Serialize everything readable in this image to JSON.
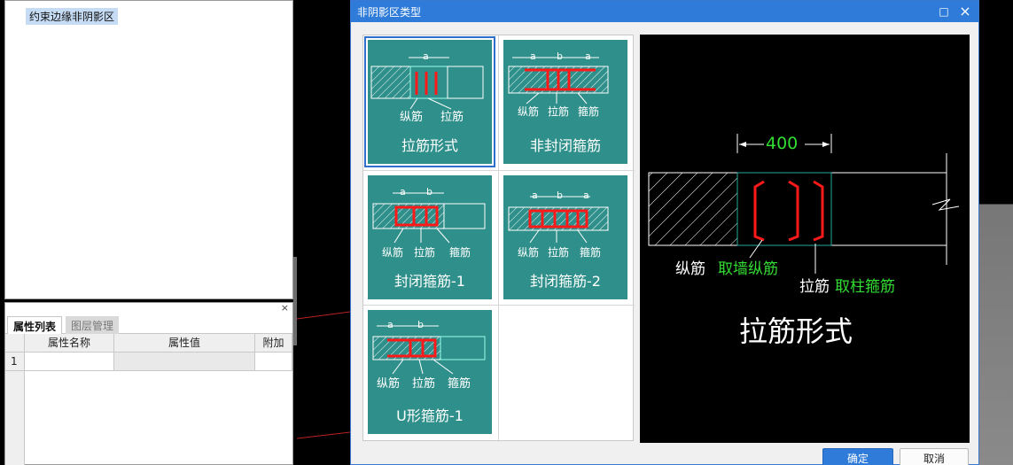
{
  "tree": {
    "selected_item": "约束边缘非阴影区"
  },
  "properties": {
    "tabs": [
      "属性列表",
      "图层管理"
    ],
    "columns": [
      "属性名称",
      "属性值",
      "附加"
    ],
    "rows": [
      {
        "index": "1",
        "name": "",
        "value": "",
        "extra": ""
      }
    ],
    "close_glyph": "×"
  },
  "dialog": {
    "title": "非阴影区类型",
    "max_glyph": "□",
    "close_glyph": "×",
    "options": [
      {
        "label": "拉筋形式",
        "selected": true,
        "dims": [
          "a"
        ],
        "legend": [
          "纵筋",
          "拉筋"
        ]
      },
      {
        "label": "非封闭箍筋",
        "selected": false,
        "dims": [
          "a",
          "b",
          "a"
        ],
        "legend": [
          "纵筋",
          "拉筋",
          "箍筋"
        ]
      },
      {
        "label": "封闭箍筋-1",
        "selected": false,
        "dims": [
          "a",
          "b"
        ],
        "legend": [
          "纵筋",
          "拉筋",
          "箍筋"
        ]
      },
      {
        "label": "封闭箍筋-2",
        "selected": false,
        "dims": [
          "a",
          "b",
          "a"
        ],
        "legend": [
          "纵筋",
          "拉筋",
          "箍筋"
        ]
      },
      {
        "label": "U形箍筋-1",
        "selected": false,
        "dims": [
          "a",
          "b"
        ],
        "legend": [
          "纵筋",
          "拉筋",
          "箍筋"
        ]
      }
    ],
    "preview": {
      "dimension": "400",
      "label_zongjin": "纵筋",
      "label_zongjin_source": "取墙纵筋",
      "label_lajin": "拉筋",
      "label_lajin_source": "取柱箍筋",
      "title": "拉筋形式"
    },
    "ok_label": "确定",
    "cancel_label": "取消"
  },
  "colors": {
    "accent": "#2e7bd9",
    "tile": "#2f8f8a",
    "rebar": "#ff1a1a",
    "green_text": "#33dd33"
  }
}
